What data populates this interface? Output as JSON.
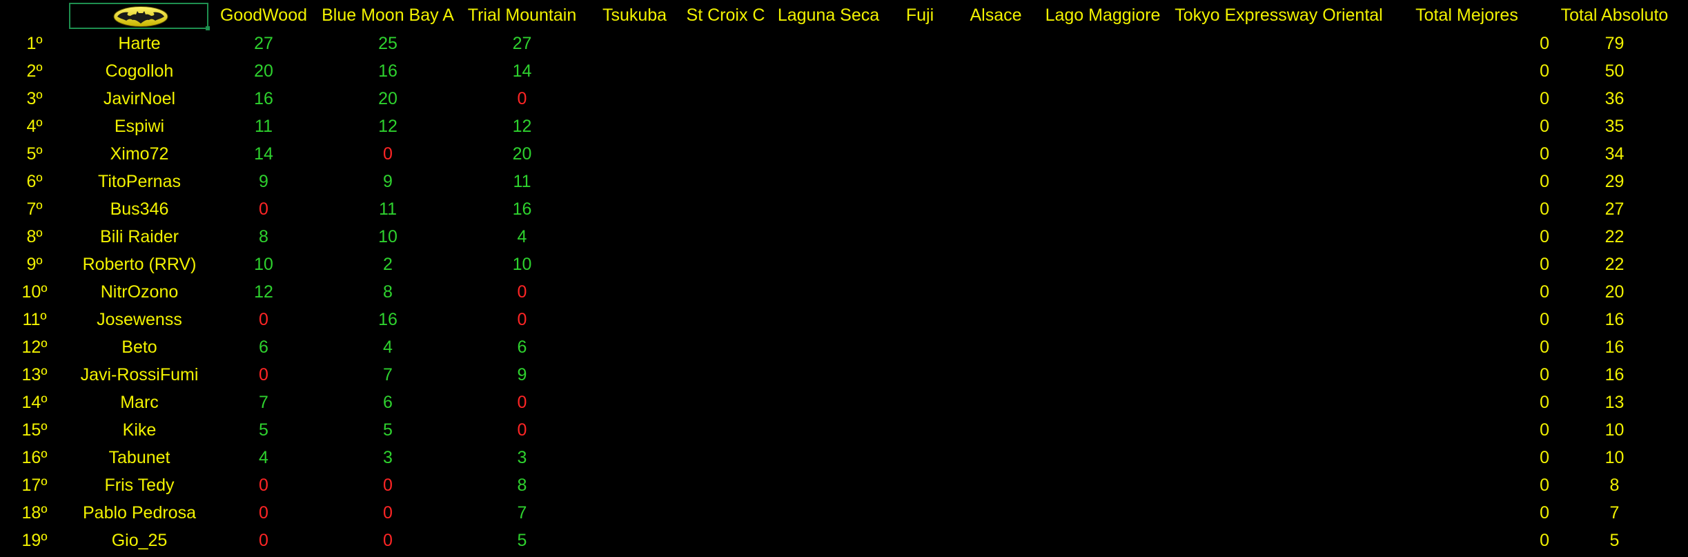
{
  "header": {
    "logo_icon": "batman-logo",
    "columns": [
      "GoodWood",
      "Blue Moon Bay A",
      "Trial Mountain",
      "Tsukuba",
      "St Croix C",
      "Laguna Seca",
      "Fuji",
      "Alsace",
      "Lago Maggiore",
      "Tokyo Expressway Oriental",
      "Total Mejores",
      "Total Absoluto"
    ]
  },
  "colors": {
    "header_text": "#f2f200",
    "positive_points": "#2ed12e",
    "zero_points": "#ff2525",
    "background": "#000000"
  },
  "rows": [
    {
      "pos": "1º",
      "name": "Harte",
      "goodwood": "27",
      "blue_moon": "25",
      "trial": "27",
      "mejores": "0",
      "absoluto": "79"
    },
    {
      "pos": "2º",
      "name": "Cogolloh",
      "goodwood": "20",
      "blue_moon": "16",
      "trial": "14",
      "mejores": "0",
      "absoluto": "50"
    },
    {
      "pos": "3º",
      "name": "JavirNoel",
      "goodwood": "16",
      "blue_moon": "20",
      "trial": "0",
      "mejores": "0",
      "absoluto": "36"
    },
    {
      "pos": "4º",
      "name": "Espiwi",
      "goodwood": "11",
      "blue_moon": "12",
      "trial": "12",
      "mejores": "0",
      "absoluto": "35"
    },
    {
      "pos": "5º",
      "name": "Ximo72",
      "goodwood": "14",
      "blue_moon": "0",
      "trial": "20",
      "mejores": "0",
      "absoluto": "34"
    },
    {
      "pos": "6º",
      "name": "TitoPernas",
      "goodwood": "9",
      "blue_moon": "9",
      "trial": "11",
      "mejores": "0",
      "absoluto": "29"
    },
    {
      "pos": "7º",
      "name": "Bus346",
      "goodwood": "0",
      "blue_moon": "11",
      "trial": "16",
      "mejores": "0",
      "absoluto": "27"
    },
    {
      "pos": "8º",
      "name": "Bili Raider",
      "goodwood": "8",
      "blue_moon": "10",
      "trial": "4",
      "mejores": "0",
      "absoluto": "22"
    },
    {
      "pos": "9º",
      "name": "Roberto (RRV)",
      "goodwood": "10",
      "blue_moon": "2",
      "trial": "10",
      "mejores": "0",
      "absoluto": "22"
    },
    {
      "pos": "10º",
      "name": "NitrOzono",
      "goodwood": "12",
      "blue_moon": "8",
      "trial": "0",
      "mejores": "0",
      "absoluto": "20"
    },
    {
      "pos": "11º",
      "name": "Josewenss",
      "goodwood": "0",
      "blue_moon": "16",
      "trial": "0",
      "mejores": "0",
      "absoluto": "16"
    },
    {
      "pos": "12º",
      "name": "Beto",
      "goodwood": "6",
      "blue_moon": "4",
      "trial": "6",
      "mejores": "0",
      "absoluto": "16"
    },
    {
      "pos": "13º",
      "name": "Javi-RossiFumi",
      "goodwood": "0",
      "blue_moon": "7",
      "trial": "9",
      "mejores": "0",
      "absoluto": "16"
    },
    {
      "pos": "14º",
      "name": "Marc",
      "goodwood": "7",
      "blue_moon": "6",
      "trial": "0",
      "mejores": "0",
      "absoluto": "13"
    },
    {
      "pos": "15º",
      "name": "Kike",
      "goodwood": "5",
      "blue_moon": "5",
      "trial": "0",
      "mejores": "0",
      "absoluto": "10"
    },
    {
      "pos": "16º",
      "name": "Tabunet",
      "goodwood": "4",
      "blue_moon": "3",
      "trial": "3",
      "mejores": "0",
      "absoluto": "10"
    },
    {
      "pos": "17º",
      "name": "Fris Tedy",
      "goodwood": "0",
      "blue_moon": "0",
      "trial": "8",
      "mejores": "0",
      "absoluto": "8"
    },
    {
      "pos": "18º",
      "name": "Pablo Pedrosa",
      "goodwood": "0",
      "blue_moon": "0",
      "trial": "7",
      "mejores": "0",
      "absoluto": "7"
    },
    {
      "pos": "19º",
      "name": "Gio_25",
      "goodwood": "0",
      "blue_moon": "0",
      "trial": "5",
      "mejores": "0",
      "absoluto": "5"
    }
  ]
}
